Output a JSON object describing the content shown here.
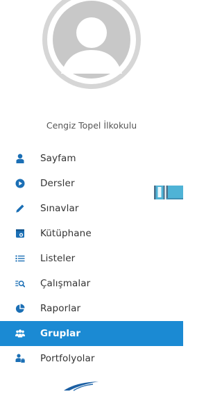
{
  "school": {
    "name": "Cengiz Topel İlkokulu"
  },
  "menu": {
    "items": [
      {
        "label": "Sayfam",
        "icon": "user-icon"
      },
      {
        "label": "Dersler",
        "icon": "play-circle-icon"
      },
      {
        "label": "Sınavlar",
        "icon": "pencil-icon"
      },
      {
        "label": "Kütüphane",
        "icon": "library-icon"
      },
      {
        "label": "Listeler",
        "icon": "list-icon"
      },
      {
        "label": "Çalışmalar",
        "icon": "search-list-icon"
      },
      {
        "label": "Raporlar",
        "icon": "pie-chart-icon"
      },
      {
        "label": "Gruplar",
        "icon": "users-icon",
        "active": true
      },
      {
        "label": "Portfolyolar",
        "icon": "portfolio-user-icon"
      }
    ]
  },
  "colors": {
    "accent": "#1b8ad3",
    "icon": "#1b6fb5",
    "text": "#333333"
  }
}
